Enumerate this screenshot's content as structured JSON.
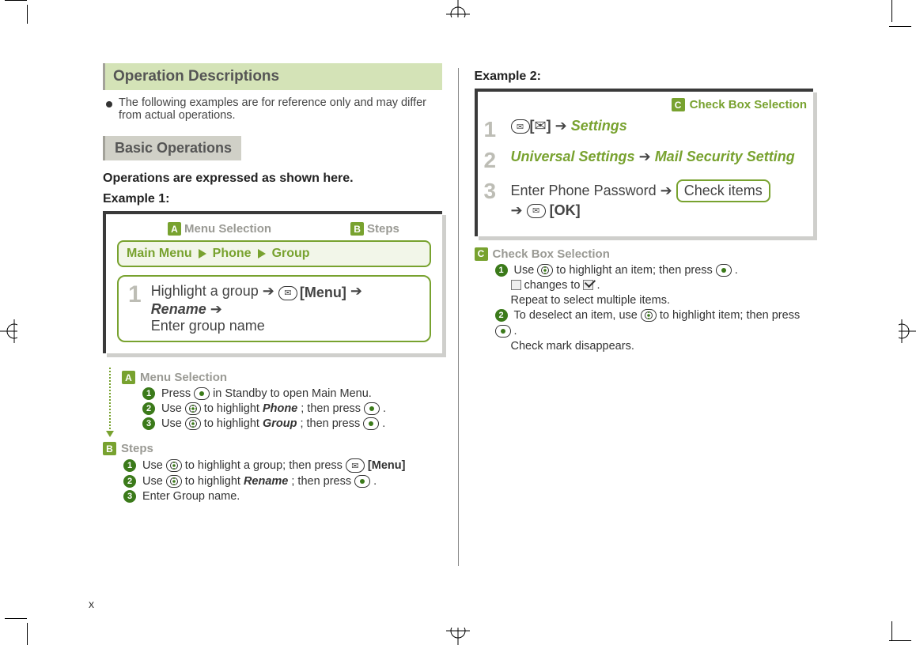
{
  "page_number": "x",
  "title": "Operation Descriptions",
  "note": "The following examples are for reference only and may differ from actual operations.",
  "subheading": "Basic Operations",
  "intro_sentence": "Operations are expressed as shown here.",
  "example1_label": "Example 1:",
  "callout_a_label": "Menu Selection",
  "callout_b_label": "Steps",
  "menu_path": {
    "seg1": "Main Menu",
    "seg2": "Phone",
    "seg3": "Group"
  },
  "ex1_step_num": "1",
  "ex1_step_parts": {
    "p1": "Highlight a group",
    "p2_key_label": "[Menu]",
    "p3_italic": "Rename",
    "p4": "Enter group name"
  },
  "explain_a_title": "Menu Selection",
  "explain_a_items": {
    "i1a": "Press",
    "i1b": "in Standby to open Main Menu.",
    "i2a": "Use",
    "i2b": "to highlight",
    "i2c": "Phone",
    "i2d": "; then press",
    "i3a": "Use",
    "i3b": "to highlight",
    "i3c": "Group",
    "i3d": "; then press"
  },
  "explain_b_title": "Steps",
  "explain_b_items": {
    "i1a": "Use",
    "i1b": "to highlight a group; then press",
    "i1c": "[Menu]",
    "i2a": "Use",
    "i2b": "to highlight",
    "i2c": "Rename",
    "i2d": "; then press",
    "i3": "Enter Group name."
  },
  "example2_label": "Example 2:",
  "callout_c_label": "Check Box Selection",
  "ex2_steps": {
    "s1": {
      "n": "1",
      "link": "Settings"
    },
    "s2": {
      "n": "2",
      "link1": "Universal Settings",
      "link2": "Mail Security Setting"
    },
    "s3": {
      "n": "3",
      "pre": "Enter Phone Password",
      "box": "Check items",
      "ok": "[OK]"
    }
  },
  "explain_c_title": "Check Box Selection",
  "explain_c_items": {
    "i1a": "Use",
    "i1b": "to highlight an item; then press",
    "i1c": ".",
    "chg_a": "changes to",
    "chg_b": ".",
    "repeat": "Repeat to select multiple items.",
    "i2a": "To deselect an item, use",
    "i2b": "to highlight item; then press",
    "i2c": ".",
    "disappear": "Check mark disappears."
  },
  "badges": {
    "A": "A",
    "B": "B",
    "C": "C"
  }
}
